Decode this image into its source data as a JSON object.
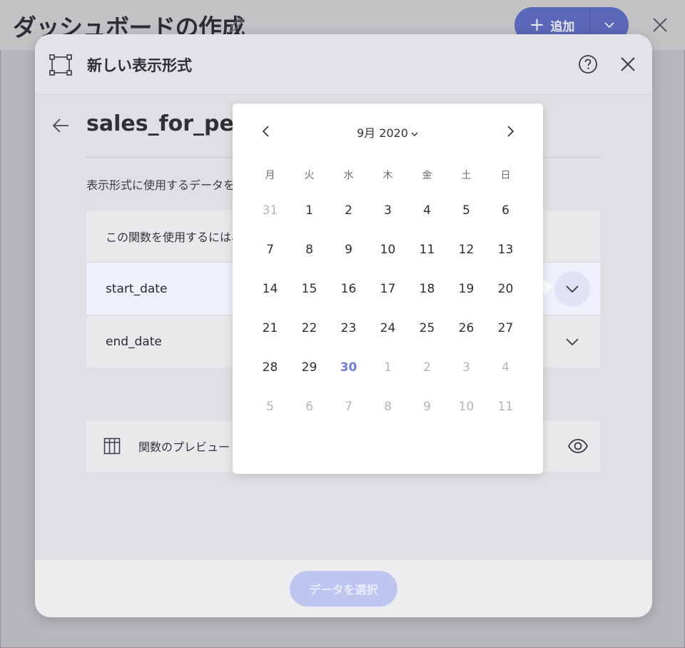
{
  "app": {
    "title": "ダッシュボードの作成",
    "add_label": "追加"
  },
  "modal": {
    "title": "新しい表示形式",
    "function_title": "sales_for_perio",
    "instruction": "表示形式に使用するデータを選",
    "param_header": "この関数を使用するには、",
    "params": [
      {
        "name": "start_date",
        "state": "active"
      },
      {
        "name": "end_date",
        "state": "idle"
      }
    ],
    "preview_label": "関数のプレビュー",
    "select_data_label": "データを選択"
  },
  "calendar": {
    "month_label": "9月 2020",
    "weekdays": [
      "月",
      "火",
      "水",
      "木",
      "金",
      "土",
      "日"
    ],
    "today": "30",
    "days": [
      {
        "d": "31",
        "other": true
      },
      {
        "d": "1"
      },
      {
        "d": "2"
      },
      {
        "d": "3"
      },
      {
        "d": "4"
      },
      {
        "d": "5"
      },
      {
        "d": "6"
      },
      {
        "d": "7"
      },
      {
        "d": "8"
      },
      {
        "d": "9"
      },
      {
        "d": "10"
      },
      {
        "d": "11"
      },
      {
        "d": "12"
      },
      {
        "d": "13"
      },
      {
        "d": "14"
      },
      {
        "d": "15"
      },
      {
        "d": "16"
      },
      {
        "d": "17"
      },
      {
        "d": "18"
      },
      {
        "d": "19"
      },
      {
        "d": "20"
      },
      {
        "d": "21"
      },
      {
        "d": "22"
      },
      {
        "d": "23"
      },
      {
        "d": "24"
      },
      {
        "d": "25"
      },
      {
        "d": "26"
      },
      {
        "d": "27"
      },
      {
        "d": "28"
      },
      {
        "d": "29"
      },
      {
        "d": "30",
        "today": true
      },
      {
        "d": "1",
        "other": true
      },
      {
        "d": "2",
        "other": true
      },
      {
        "d": "3",
        "other": true
      },
      {
        "d": "4",
        "other": true
      },
      {
        "d": "5",
        "other": true
      },
      {
        "d": "6",
        "other": true
      },
      {
        "d": "7",
        "other": true
      },
      {
        "d": "8",
        "other": true
      },
      {
        "d": "9",
        "other": true
      },
      {
        "d": "10",
        "other": true
      },
      {
        "d": "11",
        "other": true
      }
    ]
  },
  "colors": {
    "accent": "#6d7fd6",
    "button_primary": "#5b67b8",
    "button_disabled": "#bdc6ef"
  }
}
